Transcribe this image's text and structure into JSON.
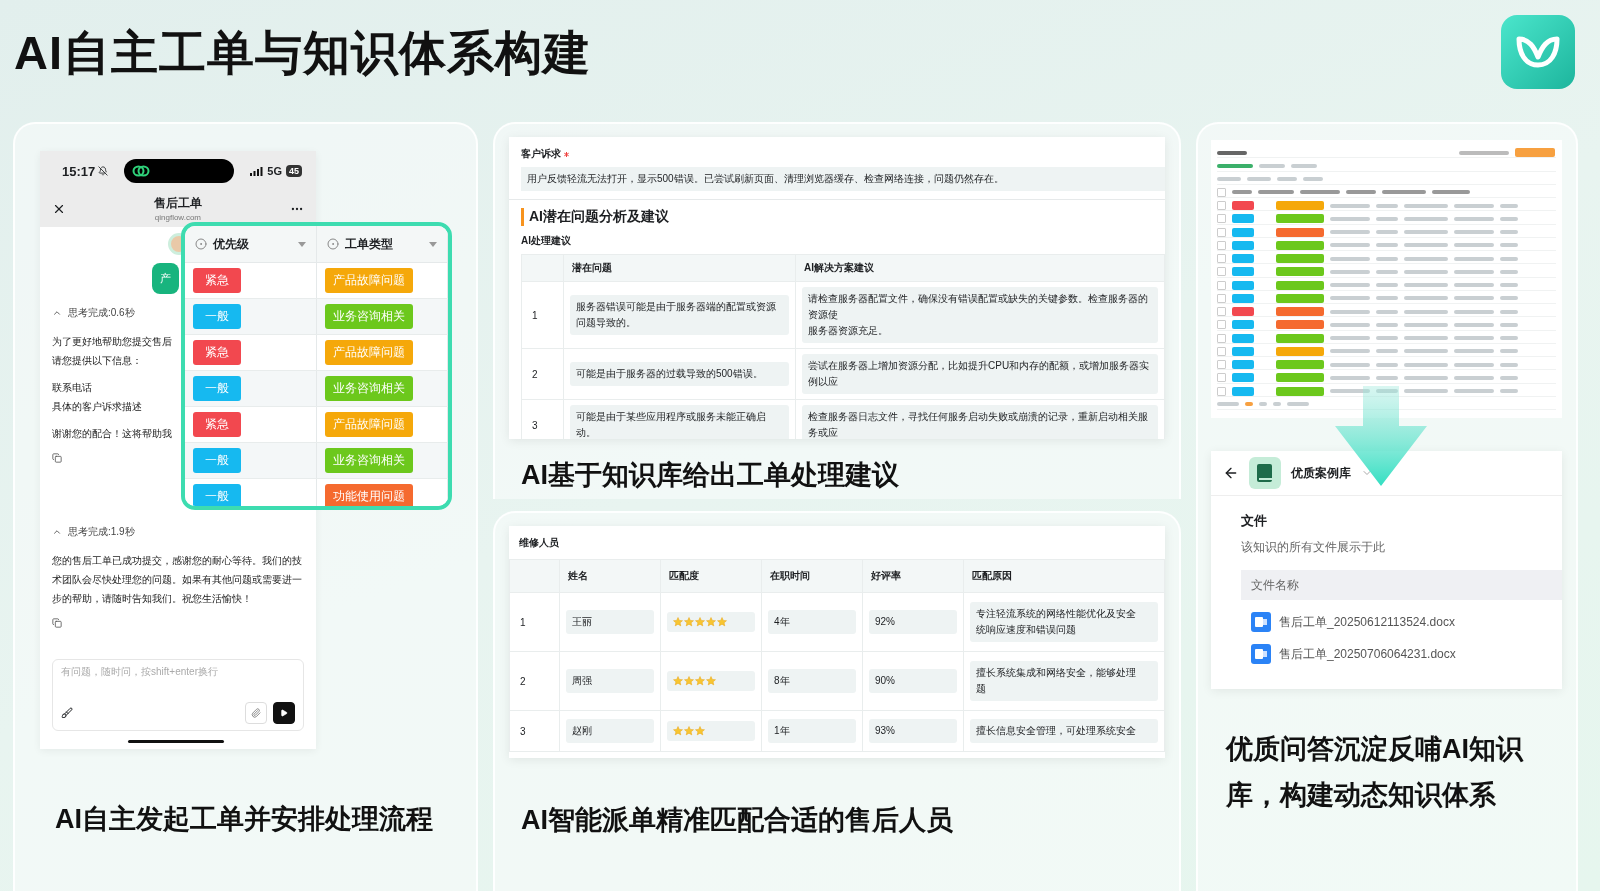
{
  "title": "AI自主工单与知识体系构建",
  "chat_panel": {
    "phone": {
      "time": "15:17",
      "network": "5G",
      "battery": "45",
      "page_title": "售后工单",
      "domain": "qingflow.com"
    },
    "bubble": "产",
    "messages": [
      {
        "kind": "thinking",
        "text": "思考完成:0.6秒",
        "expanded": true
      },
      {
        "kind": "text",
        "lines": [
          "为了更好地帮助您提交售后",
          "请您提供以下信息："
        ]
      },
      {
        "kind": "text",
        "lines": [
          "联系电话",
          "具体的客户诉求描述"
        ]
      },
      {
        "kind": "text",
        "lines": [
          "谢谢您的配合！这将帮助我"
        ]
      },
      {
        "kind": "copy"
      },
      {
        "kind": "thinking",
        "text": "思考完成:1.9秒",
        "expanded": true
      },
      {
        "kind": "text",
        "lines": [
          "您的售后工单已成功提交，感谢您的耐心等待。我们的技术团队会尽快处理您的问题。如果有其他问题或需要进一步的帮助，请随时告知我们。祝您生活愉快！"
        ]
      },
      {
        "kind": "copy"
      }
    ],
    "input": {
      "placeholder": "有问题，随时问，按shift+enter换行"
    },
    "table": {
      "columns": [
        "优先级",
        "工单类型"
      ],
      "rows": [
        {
          "priority": {
            "label": "紧急",
            "color": "#f2484f"
          },
          "type": {
            "label": "产品故障问题",
            "color": "#f5a80a"
          }
        },
        {
          "priority": {
            "label": "一般",
            "color": "#16b9f0"
          },
          "type": {
            "label": "业务咨询相关",
            "color": "#6cc81c"
          }
        },
        {
          "priority": {
            "label": "紧急",
            "color": "#f2484f"
          },
          "type": {
            "label": "产品故障问题",
            "color": "#f5a80a"
          }
        },
        {
          "priority": {
            "label": "一般",
            "color": "#16b9f0"
          },
          "type": {
            "label": "业务咨询相关",
            "color": "#6cc81c"
          }
        },
        {
          "priority": {
            "label": "紧急",
            "color": "#f2484f"
          },
          "type": {
            "label": "产品故障问题",
            "color": "#f5a80a"
          }
        },
        {
          "priority": {
            "label": "一般",
            "color": "#16b9f0"
          },
          "type": {
            "label": "业务咨询相关",
            "color": "#6cc81c"
          }
        },
        {
          "priority": {
            "label": "一般",
            "color": "#16b9f0"
          },
          "type": {
            "label": "功能使用问题",
            "color": "#f56a2f"
          }
        }
      ]
    },
    "caption": "AI自主发起工单并安排处理流程"
  },
  "suggestion_panel": {
    "field_label": "客户诉求",
    "required": true,
    "field_value": "用户反馈轻流无法打开，显示500错误。已尝试刷新页面、清理浏览器缓存、检查网络连接，问题仍然存在。",
    "section_title": "AI潜在问题分析及建议",
    "table_label": "AI处理建议",
    "columns": [
      "潜在问题",
      "AI解决方案建议"
    ],
    "rows": [
      {
        "index": "1",
        "problem": "服务器错误可能是由于服务器端的配置或资源问题导致的。",
        "solution": [
          "请检查服务器配置文件，确保没有错误配置或缺失的关键参数。检查服务器的资源使",
          "服务器资源充足。"
        ]
      },
      {
        "index": "2",
        "problem": "可能是由于服务器的过载导致的500错误。",
        "solution": [
          "尝试在服务器上增加资源分配，比如提升CPU和内存的配额，或增加服务器实例以应"
        ]
      },
      {
        "index": "3",
        "problem": "可能是由于某些应用程序或服务未能正确启动。",
        "solution": [
          "检查服务器日志文件，寻找任何服务启动失败或崩溃的记录，重新启动相关服务或应"
        ]
      }
    ],
    "caption": "AI基于知识库给出工单处理建议"
  },
  "dispatch_panel": {
    "table_label": "维修人员",
    "columns": [
      "姓名",
      "匹配度",
      "在职时间",
      "好评率",
      "匹配原因"
    ],
    "rows": [
      {
        "index": "1",
        "name": "王丽",
        "stars": 5,
        "tenure": "4年",
        "rating": "92%",
        "reason": [
          "专注轻流系统的网络性能优化及安全",
          "统响应速度和错误问题"
        ]
      },
      {
        "index": "2",
        "name": "周强",
        "stars": 4,
        "tenure": "8年",
        "rating": "90%",
        "reason": [
          "擅长系统集成和网络安全，能够处理",
          "题"
        ]
      },
      {
        "index": "3",
        "name": "赵刚",
        "stars": 3,
        "tenure": "1年",
        "rating": "93%",
        "reason": [
          "擅长信息安全管理，可处理系统安全"
        ]
      }
    ],
    "caption": "AI智能派单精准匹配合适的售后人员"
  },
  "knowledge_panel": {
    "preview_rows": [
      {
        "tags": [
          {
            "color": "#f2484f"
          },
          {
            "color": "#f5a80a"
          }
        ]
      },
      {
        "tags": [
          {
            "color": "#16b9f0"
          },
          {
            "color": "#6cc81c"
          }
        ]
      },
      {
        "tags": [
          {
            "color": "#16b9f0"
          },
          {
            "color": "#f56a2f"
          }
        ]
      },
      {
        "tags": [
          {
            "color": "#16b9f0"
          },
          {
            "color": "#6cc81c"
          }
        ]
      },
      {
        "tags": [
          {
            "color": "#16b9f0"
          },
          {
            "color": "#6cc81c"
          }
        ]
      },
      {
        "tags": [
          {
            "color": "#16b9f0"
          },
          {
            "color": "#6cc81c"
          }
        ]
      },
      {
        "tags": [
          {
            "color": "#16b9f0"
          },
          {
            "color": "#6cc81c"
          }
        ]
      },
      {
        "tags": [
          {
            "color": "#16b9f0"
          },
          {
            "color": "#6cc81c"
          }
        ]
      },
      {
        "tags": [
          {
            "color": "#f2484f"
          },
          {
            "color": "#f56a2f"
          }
        ]
      },
      {
        "tags": [
          {
            "color": "#16b9f0"
          },
          {
            "color": "#f56a2f"
          }
        ]
      },
      {
        "tags": [
          {
            "color": "#16b9f0"
          },
          {
            "color": "#6cc81c"
          }
        ]
      },
      {
        "tags": [
          {
            "color": "#16b9f0"
          },
          {
            "color": "#f5a80a"
          }
        ]
      },
      {
        "tags": [
          {
            "color": "#16b9f0"
          },
          {
            "color": "#6cc81c"
          }
        ]
      },
      {
        "tags": [
          {
            "color": "#16b9f0"
          },
          {
            "color": "#6cc81c"
          }
        ]
      },
      {
        "tags": [
          {
            "color": "#16b9f0"
          },
          {
            "color": "#6cc81c"
          }
        ]
      }
    ],
    "library": "优质案例库",
    "heading": "文件",
    "description": "该知识的所有文件展示于此",
    "column": "文件名称",
    "files": [
      "售后工单_20250612113524.docx",
      "售后工单_20250706064231.docx"
    ],
    "caption": "优质问答沉淀反哺AI知识库，构建动态知识体系"
  }
}
